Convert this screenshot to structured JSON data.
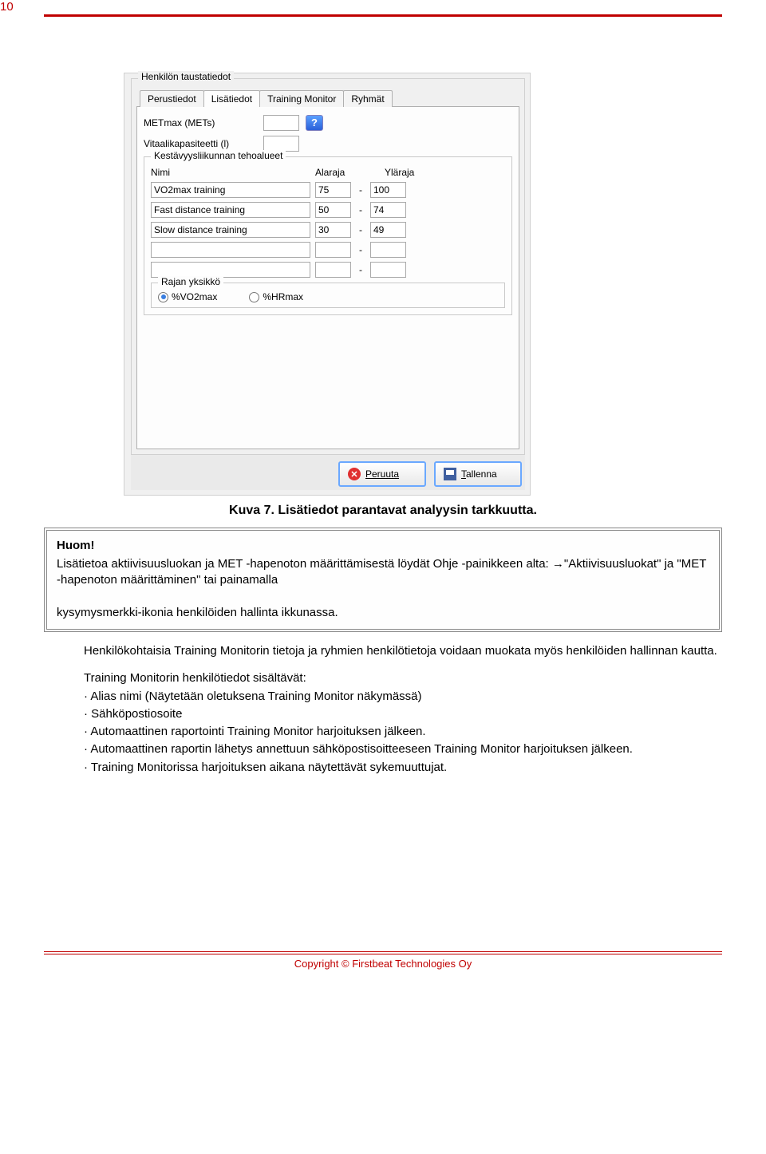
{
  "page_number": "10",
  "screenshot": {
    "group_title": "Henkilön taustatiedot",
    "tabs": [
      "Perustiedot",
      "Lisätiedot",
      "Training Monitor",
      "Ryhmät"
    ],
    "active_tab": "Lisätiedot",
    "fields": {
      "metmax_label": "METmax (METs)",
      "metmax_value": "",
      "vital_label": "Vitaalikapasiteetti (l)",
      "vital_value": ""
    },
    "zones": {
      "legend": "Kestävyysliikunnan tehoalueet",
      "col_name": "Nimi",
      "col_low": "Alaraja",
      "col_high": "Yläraja",
      "rows": [
        {
          "name": "VO2max training",
          "low": "75",
          "high": "100"
        },
        {
          "name": "Fast distance training",
          "low": "50",
          "high": "74"
        },
        {
          "name": "Slow distance training",
          "low": "30",
          "high": "49"
        },
        {
          "name": "",
          "low": "",
          "high": ""
        },
        {
          "name": "",
          "low": "",
          "high": ""
        }
      ],
      "unit": {
        "legend": "Rajan yksikkö",
        "opt1": "%VO2max",
        "opt2": "%HRmax",
        "selected": "%VO2max"
      }
    },
    "buttons": {
      "cancel": "Peruuta",
      "save": "Tallenna"
    }
  },
  "caption": "Kuva 7. Lisätiedot parantavat analyysin tarkkuutta.",
  "note": {
    "title": "Huom!",
    "body_1": "Lisätietoa aktiivisuusluokan ja MET -hapenoton määrittämisestä löydät Ohje -painikkeen alta: →\"Aktiivisuusluokat\" ja \"MET -hapenoton määrittäminen\" tai painamalla",
    "body_2": "kysymysmerkki-ikonia henkilöiden hallinta ikkunassa."
  },
  "paragraphs": {
    "p1": "Henkilökohtaisia Training Monitorin tietoja ja ryhmien henkilötietoja voidaan muokata myös henkilöiden hallinnan kautta.",
    "p2": "Training Monitorin henkilötiedot sisältävät:",
    "b1": "· Alias nimi (Näytetään oletuksena Training Monitor näkymässä)",
    "b2": "· Sähköpostiosoite",
    "b3": "· Automaattinen raportointi Training Monitor harjoituksen jälkeen.",
    "b4": "· Automaattinen raportin lähetys annettuun sähköpostisoitteeseen Training Monitor harjoituksen jälkeen.",
    "b5": "· Training Monitorissa harjoituksen aikana näytettävät sykemuuttujat."
  },
  "footer": "Copyright © Firstbeat Technologies Oy"
}
